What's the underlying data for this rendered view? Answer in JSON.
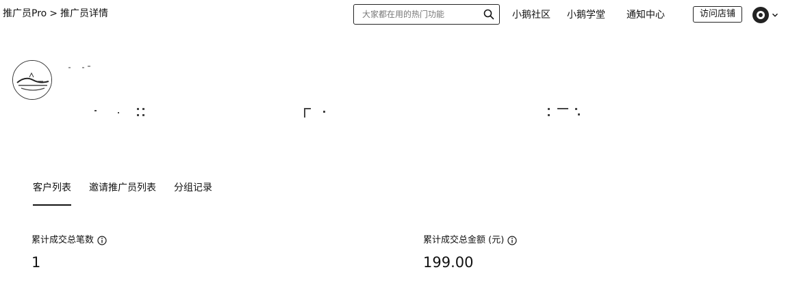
{
  "breadcrumb": {
    "parent": "推广员Pro",
    "separator": ">",
    "current": "推广员详情"
  },
  "search": {
    "placeholder": "大家都在用的热门功能",
    "icon": "search-icon"
  },
  "nav": {
    "community": "小鹅社区",
    "academy": "小鹅学堂",
    "notifications": "通知中心"
  },
  "header": {
    "visit_store": "访问店铺"
  },
  "tabs": [
    {
      "label": "客户列表",
      "active": true
    },
    {
      "label": "邀请推广员列表",
      "active": false
    },
    {
      "label": "分组记录",
      "active": false
    }
  ],
  "stats": {
    "orders": {
      "label": "累计成交总笔数",
      "value": "1"
    },
    "amount": {
      "label": "累计成交总金额 (元)",
      "value": "199.00"
    }
  },
  "colors": {
    "text": "#111111",
    "border": "#222222",
    "background": "#ffffff"
  }
}
